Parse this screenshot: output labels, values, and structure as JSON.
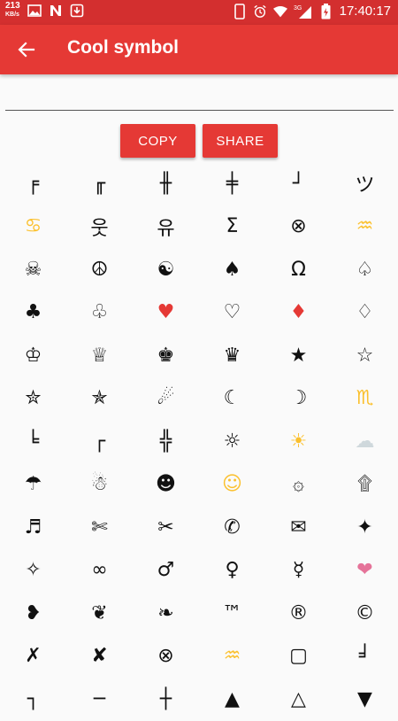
{
  "status_bar": {
    "net_speed": "213",
    "net_unit": "KB/s",
    "network": "3G",
    "time": "17:40:17",
    "icons": [
      "image-icon",
      "notification-n-icon",
      "download-icon",
      "phone-icon",
      "alarm-icon",
      "wifi-icon",
      "signal-icon",
      "battery-charging-icon"
    ]
  },
  "app_bar": {
    "title": "Cool symbol",
    "back_icon": "arrow-back-icon"
  },
  "input": {
    "value": "",
    "placeholder": ""
  },
  "buttons": {
    "copy": "COPY",
    "share": "SHARE"
  },
  "colors": {
    "primary": "#e53935",
    "status_bar": "#d32f2f",
    "heart_red": "#e53935",
    "yellow": "#fbc02d",
    "pink": "#e57399"
  },
  "symbols": [
    {
      "t": "╒"
    },
    {
      "t": "╓"
    },
    {
      "t": "╫"
    },
    {
      "t": "╪"
    },
    {
      "t": "┘"
    },
    {
      "t": "ツ"
    },
    {
      "t": "♋",
      "c": "#fbc02d"
    },
    {
      "t": "웃"
    },
    {
      "t": "유"
    },
    {
      "t": "Σ"
    },
    {
      "t": "⊗"
    },
    {
      "t": "♒",
      "c": "#fbc02d"
    },
    {
      "t": "☠"
    },
    {
      "t": "☮"
    },
    {
      "t": "☯"
    },
    {
      "t": "♠"
    },
    {
      "t": "Ω"
    },
    {
      "t": "♤"
    },
    {
      "t": "♣"
    },
    {
      "t": "♧"
    },
    {
      "t": "♥",
      "c": "#e53935"
    },
    {
      "t": "♡"
    },
    {
      "t": "♦",
      "c": "#e53935"
    },
    {
      "t": "♢"
    },
    {
      "t": "♔"
    },
    {
      "t": "♕"
    },
    {
      "t": "♚"
    },
    {
      "t": "♛"
    },
    {
      "t": "★"
    },
    {
      "t": "☆"
    },
    {
      "t": "✮"
    },
    {
      "t": "✯"
    },
    {
      "t": "☄"
    },
    {
      "t": "☾"
    },
    {
      "t": "☽"
    },
    {
      "t": "♏",
      "c": "#fbc02d"
    },
    {
      "t": "╘"
    },
    {
      "t": "┌"
    },
    {
      "t": "╬"
    },
    {
      "t": "☼"
    },
    {
      "t": "☀",
      "c": "#fbc02d"
    },
    {
      "t": "☁",
      "c": "#cfd8dc"
    },
    {
      "t": "☂"
    },
    {
      "t": "☃"
    },
    {
      "t": "☻"
    },
    {
      "t": "☺",
      "c": "#fbc02d"
    },
    {
      "t": "۞"
    },
    {
      "t": "۩"
    },
    {
      "t": "♬"
    },
    {
      "t": "✄"
    },
    {
      "t": "✂"
    },
    {
      "t": "✆"
    },
    {
      "t": "✉"
    },
    {
      "t": "✦"
    },
    {
      "t": "✧"
    },
    {
      "t": "∞"
    },
    {
      "t": "♂"
    },
    {
      "t": "♀"
    },
    {
      "t": "☿"
    },
    {
      "t": "❤",
      "c": "#e57399"
    },
    {
      "t": "❥"
    },
    {
      "t": "❦"
    },
    {
      "t": "❧"
    },
    {
      "t": "™"
    },
    {
      "t": "®"
    },
    {
      "t": "©"
    },
    {
      "t": "✗"
    },
    {
      "t": "✘"
    },
    {
      "t": "⊗"
    },
    {
      "t": "♒",
      "c": "#fbc02d"
    },
    {
      "t": "▢"
    },
    {
      "t": "╛"
    },
    {
      "t": "┐"
    },
    {
      "t": "─"
    },
    {
      "t": "┼"
    },
    {
      "t": "▲"
    },
    {
      "t": "△"
    },
    {
      "t": "▼"
    }
  ]
}
